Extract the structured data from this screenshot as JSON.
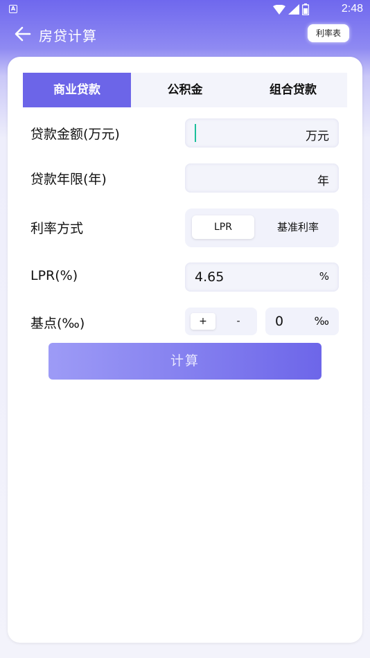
{
  "status_bar": {
    "time": "2:48",
    "app_badge": "A"
  },
  "header": {
    "title": "房贷计算",
    "rate_table_label": "利率表"
  },
  "tabs": [
    {
      "label": "商业贷款",
      "active": true
    },
    {
      "label": "公积金",
      "active": false
    },
    {
      "label": "组合贷款",
      "active": false
    }
  ],
  "form": {
    "loan_amount": {
      "label": "贷款金额(万元)",
      "value": "",
      "unit": "万元"
    },
    "loan_years": {
      "label": "贷款年限(年)",
      "value": "",
      "unit": "年"
    },
    "rate_mode": {
      "label": "利率方式",
      "options": [
        "LPR",
        "基准利率"
      ],
      "selected": "LPR"
    },
    "lpr": {
      "label": "LPR(%)",
      "value": "4.65",
      "unit": "%"
    },
    "basis_points": {
      "label": "基点(‰)",
      "plus": "+",
      "minus": "-",
      "value": "0",
      "unit": "‰"
    }
  },
  "calculate_label": "计算",
  "colors": {
    "accent": "#6c65e8",
    "cursor": "#1bbf9a",
    "field_bg": "#f3f4fb"
  }
}
